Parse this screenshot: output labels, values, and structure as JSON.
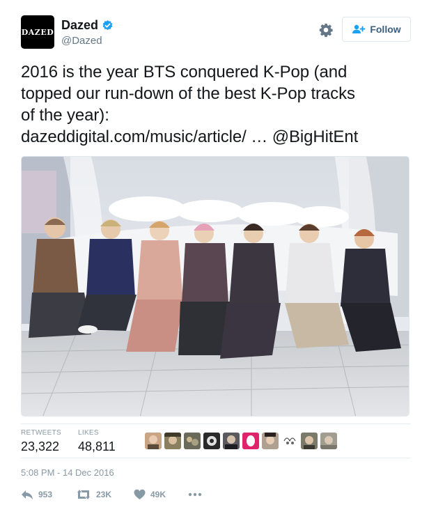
{
  "account": {
    "avatar_text": "DAZED",
    "display_name": "Dazed",
    "handle": "@Dazed",
    "verified_icon": "verified-badge-icon"
  },
  "follow_button": {
    "label": "Follow",
    "icon": "add-user-icon"
  },
  "settings_icon": "gear-icon",
  "tweet": {
    "lines": [
      "2016 is the year BTS conquered K-Pop (and",
      "topped our run-down of the best K-Pop tracks",
      "of the year):"
    ],
    "link": "dazeddigital.com/music/article/",
    "ellipsis": " … ",
    "mention": "@BigHitEnt"
  },
  "stats": {
    "retweets_label": "RETWEETS",
    "retweets_value": "23,322",
    "likes_label": "LIKES",
    "likes_value": "48,811"
  },
  "timestamp": "5:08 PM - 14 Dec 2016",
  "actions": {
    "reply_count": "953",
    "retweet_count": "23K",
    "like_count": "49K"
  },
  "colors": {
    "text": "#14171a",
    "muted": "#8899a6",
    "verified": "#1da1f2",
    "follow_text": "#3b5f7d",
    "border": "#e6ecf0"
  }
}
